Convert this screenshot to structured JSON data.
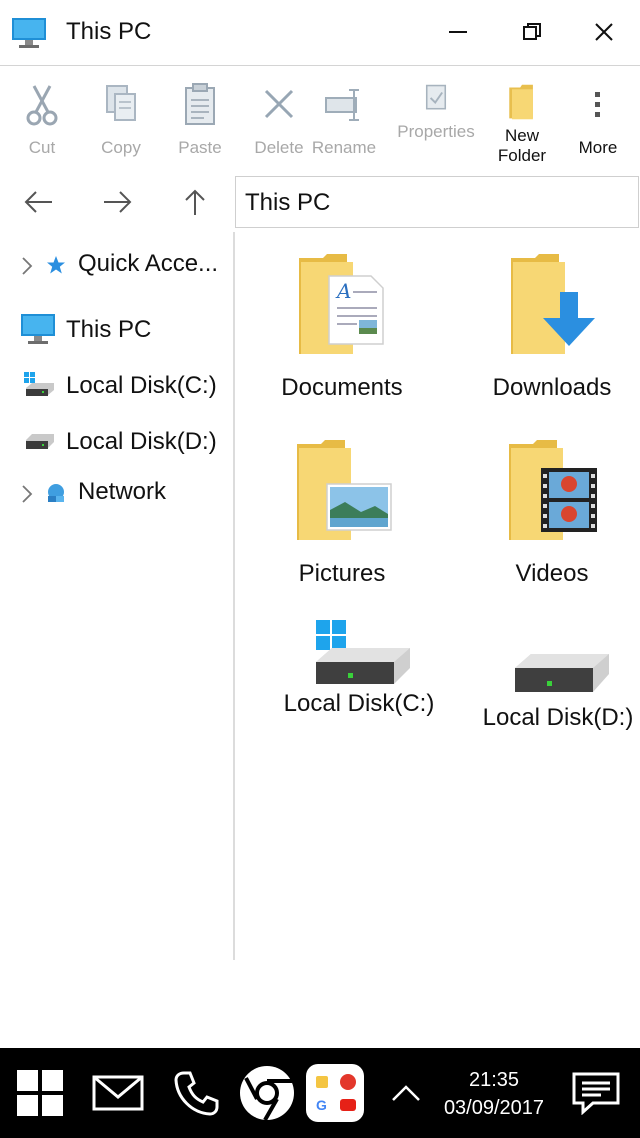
{
  "window": {
    "title": "This PC",
    "icon": "computer-icon",
    "controls": [
      "minimize-icon",
      "restore-icon",
      "close-icon"
    ]
  },
  "toolbar": {
    "cut": "Cut",
    "copy": "Copy",
    "paste": "Paste",
    "delete": "Delete",
    "rename": "Rename",
    "properties": "Properties",
    "new_folder_line1": "New",
    "new_folder_line2": "Folder",
    "more": "More"
  },
  "address": {
    "path": "This PC"
  },
  "nav": {
    "quick_access": "Quick Acce...",
    "this_pc": "This PC",
    "local_c": "Local Disk(C:)",
    "local_d": "Local Disk(D:)",
    "network": "Network"
  },
  "content": {
    "items": [
      {
        "label": "Documents",
        "icon": "documents-folder-icon"
      },
      {
        "label": "Downloads",
        "icon": "downloads-folder-icon"
      },
      {
        "label": "Pictures",
        "icon": "pictures-folder-icon"
      },
      {
        "label": "Videos",
        "icon": "videos-folder-icon"
      },
      {
        "label": "Local Disk(C:)",
        "icon": "system-drive-icon"
      },
      {
        "label": "Local Disk(D:)",
        "icon": "drive-icon"
      }
    ]
  },
  "taskbar": {
    "time": "21:35",
    "date": "03/09/2017",
    "apps": [
      "start-icon",
      "mail-icon",
      "phone-icon",
      "chrome-icon",
      "apps-folder-icon",
      "chevron-up-icon",
      "notifications-icon"
    ]
  },
  "colors": {
    "folder": "#f7d774",
    "accent": "#2b8fe0",
    "taskbar": "#000000",
    "disabled_text": "#a8a8a8"
  }
}
